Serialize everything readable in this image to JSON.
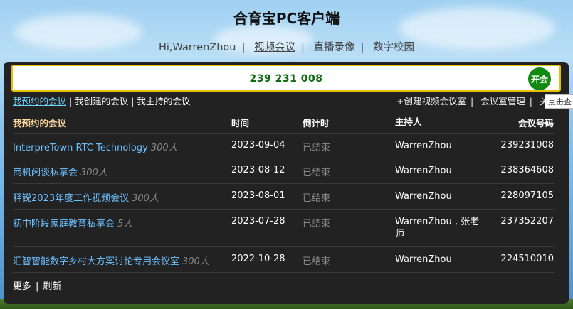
{
  "app": {
    "title": "合育宝PC客户端"
  },
  "nav": {
    "greeting": "Hi,WarrenZhou",
    "items": [
      "视频会议",
      "直播录像",
      "数字校园"
    ]
  },
  "search": {
    "value": "239 231 008",
    "open_label": "开会"
  },
  "tabs": {
    "reserved": "我预约的会议",
    "created": "我创建的会议",
    "hosted": "我主持的会议"
  },
  "links": {
    "create": "+创建视频会议室",
    "manage": "会议室管理",
    "close": "关"
  },
  "tooltip": "点击查",
  "table": {
    "headers": [
      "我预约的会议",
      "时间",
      "倒计时",
      "主持人",
      "会议号码"
    ],
    "rows": [
      {
        "name": "InterpreTown RTC Technology",
        "cap": "300人",
        "time": "2023-09-04",
        "status": "已结束",
        "host": "WarrenZhou",
        "id": "239231008"
      },
      {
        "name": "商机闲谈私享会",
        "cap": "300人",
        "time": "2023-08-12",
        "status": "已结束",
        "host": "WarrenZhou",
        "id": "238364608"
      },
      {
        "name": "释锐2023年度工作视频会议",
        "cap": "300人",
        "time": "2023-08-01",
        "status": "已结束",
        "host": "WarrenZhou",
        "id": "228097105"
      },
      {
        "name": "初中阶段家庭教育私享会",
        "cap": "5人",
        "time": "2023-07-28",
        "status": "已结束",
        "host": "WarrenZhou , 张老师",
        "id": "237352207"
      },
      {
        "name": "汇智智能数字乡村大方案讨论专用会议室",
        "cap": "300人",
        "time": "2022-10-28",
        "status": "已结束",
        "host": "WarrenZhou",
        "id": "224510010"
      }
    ]
  },
  "footer": {
    "more": "更多",
    "refresh": "刷新"
  }
}
